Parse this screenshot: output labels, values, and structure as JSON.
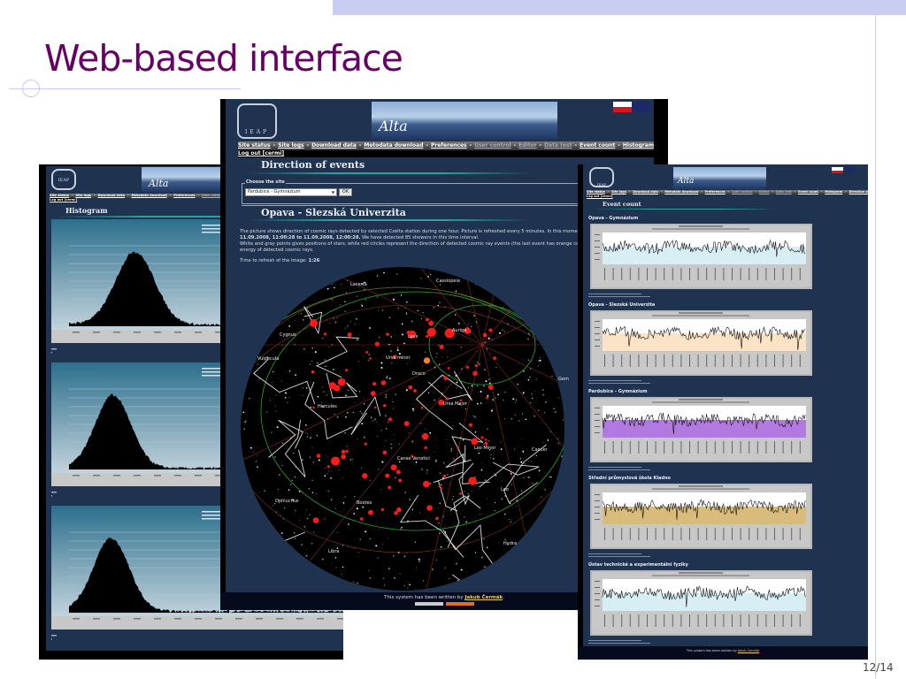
{
  "slide": {
    "title": "Web-based interface",
    "page_number": "12/14"
  },
  "common": {
    "logo_text": "IEAP",
    "banner_text": "Alta",
    "logout": "Log out [cermi]",
    "footer_prefix": "This system has been written by ",
    "footer_author": "Jakub Čermák",
    "footer_suffix": "."
  },
  "nav": [
    {
      "label": "Site status",
      "dim": false
    },
    {
      "label": "Site logs",
      "dim": false
    },
    {
      "label": "Download data",
      "dim": false
    },
    {
      "label": "Metodata download",
      "dim": false
    },
    {
      "label": "Preferences",
      "dim": false
    },
    {
      "label": "User control",
      "dim": true
    },
    {
      "label": "Editor",
      "dim": true
    },
    {
      "label": "Data test",
      "dim": true
    },
    {
      "label": "Event count",
      "dim": false
    },
    {
      "label": "Histogram",
      "dim": false
    },
    {
      "label": "Direction of events",
      "dim": false
    }
  ],
  "center": {
    "heading": "Direction of events",
    "fieldset_legend": "Choose the site",
    "site_select": "Pardubice - Gymnázium",
    "ok_button": "OK",
    "site_heading": "Opava - Slezská Univerzita",
    "para1": "The picture shows direction of cosmic rays detected by selected Czelta station during one hour. Picture is refreshed every 5 minutes. In this moment there",
    "para1b_bold": "11.09.2008, 11:00:28 to 11.09.2008, 12:00:28.",
    "para1b": " We have detected 85 showers in this time interval.",
    "para2": "White and gray points gives positions of stars, while red circles represent the direction of detected cosmic ray events (the last event has orange color). Dim",
    "para2b": "energy of detected cosmic rays.",
    "refresh_label": "Time to refresh of the image: ",
    "refresh_value": "1:26",
    "constellations": [
      "Lacerta",
      "Cassiopeia",
      "Cygnus",
      "Vulpecula",
      "Ursa minor",
      "Draco",
      "Hercules",
      "Ursa Major",
      "Lynx",
      "Auriga",
      "Gem",
      "Leo Minor",
      "Canes Venatici",
      "Cancer",
      "Leo",
      "Ophiuchus",
      "Bootes",
      "Hydra",
      "Libra"
    ]
  },
  "left": {
    "heading": "Histogram"
  },
  "right": {
    "heading": "Event count",
    "sections": [
      {
        "title": "Opava - Gymnázium",
        "fill": "#d6eef4"
      },
      {
        "title": "Opava - Slezská Univerzita",
        "fill": "#fde3c6"
      },
      {
        "title": "Pardubice - Gymnázium",
        "fill": "#b27ae0"
      },
      {
        "title": "Střední průmyslová škola Kladno",
        "fill": "#d9bb7c"
      },
      {
        "title": "Ústav technické a experimentální fyziky",
        "fill": "#d6eef4"
      }
    ]
  }
}
